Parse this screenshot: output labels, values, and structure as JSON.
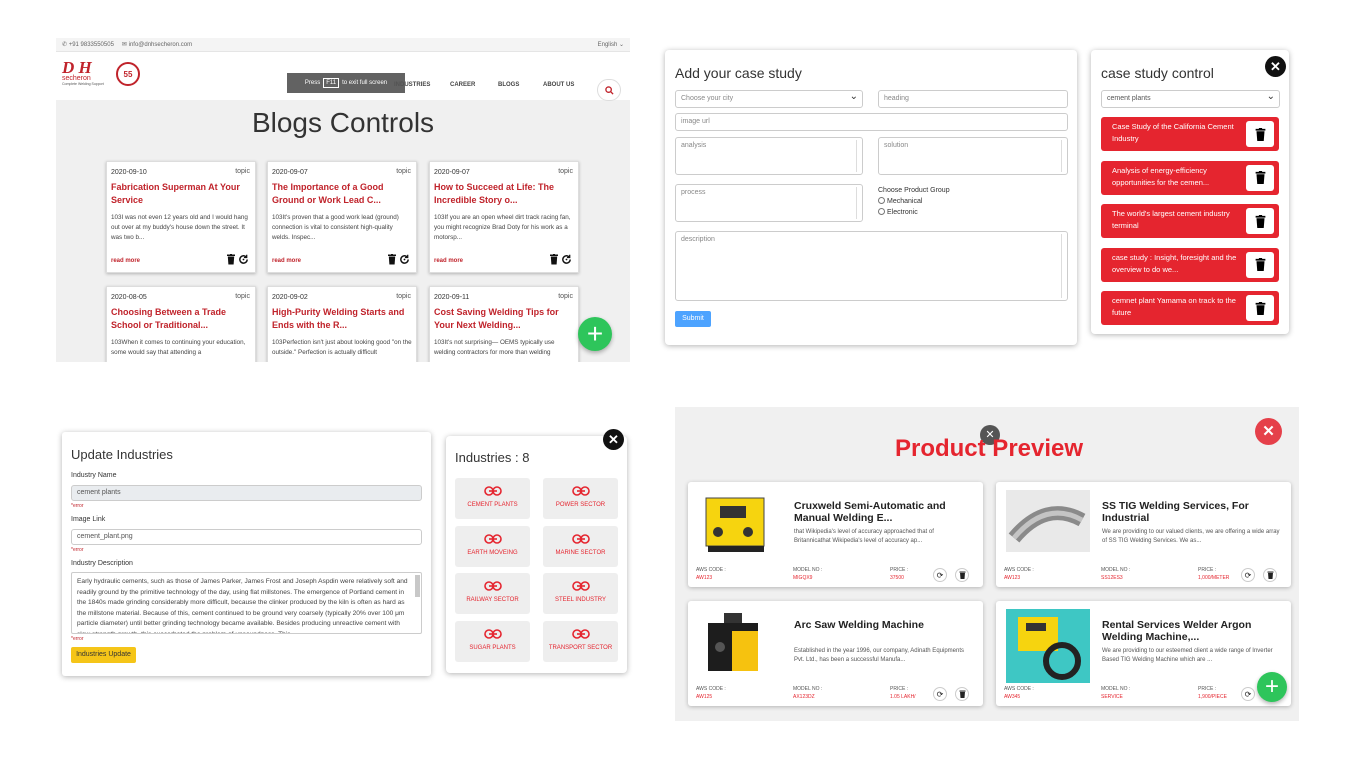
{
  "blogs": {
    "phone": "✆ +91 9833550505",
    "email": "✉ info@dnhsecheron.com",
    "language": "English",
    "logo_text": "D H",
    "logo_sub": "secheron",
    "logo_tag": "Complete Welding Support",
    "logo_badge": "55",
    "menu": [
      "INDUSTRIES",
      "CAREER",
      "BLOGS",
      "ABOUT US"
    ],
    "f11_pre": "Press",
    "f11_key": "F11",
    "f11_post": "to exit full screen",
    "heading": "Blogs Controls",
    "cards": [
      {
        "date": "2020-09-10",
        "topic": "topic",
        "title": "Fabrication Superman At Your Service",
        "text": "103I was not even 12 years old and I would hang out over at my buddy's house down the street. It was two b...",
        "read": "read more"
      },
      {
        "date": "2020-09-07",
        "topic": "topic",
        "title": "The Importance of a Good Ground or Work Lead C...",
        "text": "103It's proven that a good work lead (ground) connection is vital to consistent high-quality welds. Inspec...",
        "read": "read more"
      },
      {
        "date": "2020-09-07",
        "topic": "topic",
        "title": "How to Succeed at Life: The Incredible Story o...",
        "text": "103If you are an open wheel dirt track racing fan, you might recognize Brad Doty for his work as a motorsp...",
        "read": "read more"
      },
      {
        "date": "2020-08-05",
        "topic": "topic",
        "title": "Choosing Between a Trade School or Traditional...",
        "text": "103When it comes to continuing your education, some would say that attending a",
        "read": ""
      },
      {
        "date": "2020-09-02",
        "topic": "topic",
        "title": "High-Purity Welding Starts and Ends with the R...",
        "text": "103Perfection isn't just about looking good \"on the outside.\" Perfection is actually difficult",
        "read": ""
      },
      {
        "date": "2020-09-11",
        "topic": "topic",
        "title": "Cost Saving Welding Tips for Your Next Welding...",
        "text": "103It's not surprising— OEMS typically use welding contractors for more than welding",
        "read": ""
      }
    ]
  },
  "case_study": {
    "title": "Add your case study",
    "city_placeholder": "Choose your city",
    "heading_placeholder": "heading",
    "image_placeholder": "image url",
    "analysis_placeholder": "analysis",
    "solution_placeholder": "solution",
    "process_placeholder": "process",
    "group_label": "Choose Product Group",
    "group_options": [
      "Mechanical",
      "Electronic"
    ],
    "description_placeholder": "description",
    "submit": "Submit"
  },
  "case_control": {
    "title": "case study control",
    "selected": "cement plants",
    "items": [
      "Case Study of the California Cement Industry",
      "Analysis of energy-efficiency opportunities for the cemen...",
      "The world's largest cement industry terminal",
      "case study : Insight, foresight and the overview to do we...",
      "cemnet plant Yamama on track to the future"
    ]
  },
  "update_industries": {
    "title": "Update Industries",
    "name_label": "Industry Name",
    "name_value": "cement plants",
    "error": "*error",
    "link_label": "Image Link",
    "link_value": "cement_plant.png",
    "desc_label": "Industry Description",
    "desc_value": "Early hydraulic cements, such as those of James Parker, James Frost and Joseph Aspdin were relatively soft and readily ground by the primitive technology of the day, using flat millstones. The emergence of Portland cement in the 1840s made grinding considerably more difficult, because the clinker produced by the kiln is often as hard as the millstone material. Because of this, cement continued to be ground very coarsely (typically 20% over 100 μm particle diameter) until better grinding technology became available. Besides producing unreactive cement with slow strength growth, this exacerbated the problem of unsoundness. This",
    "button": "Industries Update"
  },
  "industries": {
    "title": "Industries : 8",
    "items": [
      "CEMENT PLANTS",
      "POWER SECTOR",
      "EARTH MOVEING",
      "MARINE SECTOR",
      "RAILWAY SECTOR",
      "STEEL INDUSTRY",
      "SUGAR PLANTS",
      "TRANSPORT SECTOR"
    ]
  },
  "products": {
    "title": "Product Preview",
    "labels": {
      "aws": "AWS CODE :",
      "model": "MODEL NO :",
      "price": "PRICE :"
    },
    "items": [
      {
        "title": "Cruxweld Semi-Automatic and Manual Welding E...",
        "desc": "that Wikipedia's level of accuracy approached that of Britannicathat Wikipedia's level of accuracy ap...",
        "aws": "AW123",
        "model": "MIGQX9",
        "price": "37500"
      },
      {
        "title": "SS TIG Welding Services, For Industrial",
        "desc": "We are providing to our valued clients, we are offering a wide array of SS TIG Welding Services. We as...",
        "aws": "AW123",
        "model": "SS12ES3",
        "price": "1,000/METER"
      },
      {
        "title": "Arc Saw Welding Machine",
        "desc": "Established in the year 1996, our company, Adinath Equipments Pvt. Ltd., has been a successful Manufa...",
        "aws": "AW125",
        "model": "AX123DZ",
        "price": "1.05 LAKH/"
      },
      {
        "title": "Rental Services Welder Argon Welding Machine,...",
        "desc": "We are providing to our esteemed client a wide range of Inverter Based TIG Welding Machine which are ...",
        "aws": "AW345",
        "model": "SERVICE",
        "price": "1,900/PIECE"
      }
    ]
  }
}
